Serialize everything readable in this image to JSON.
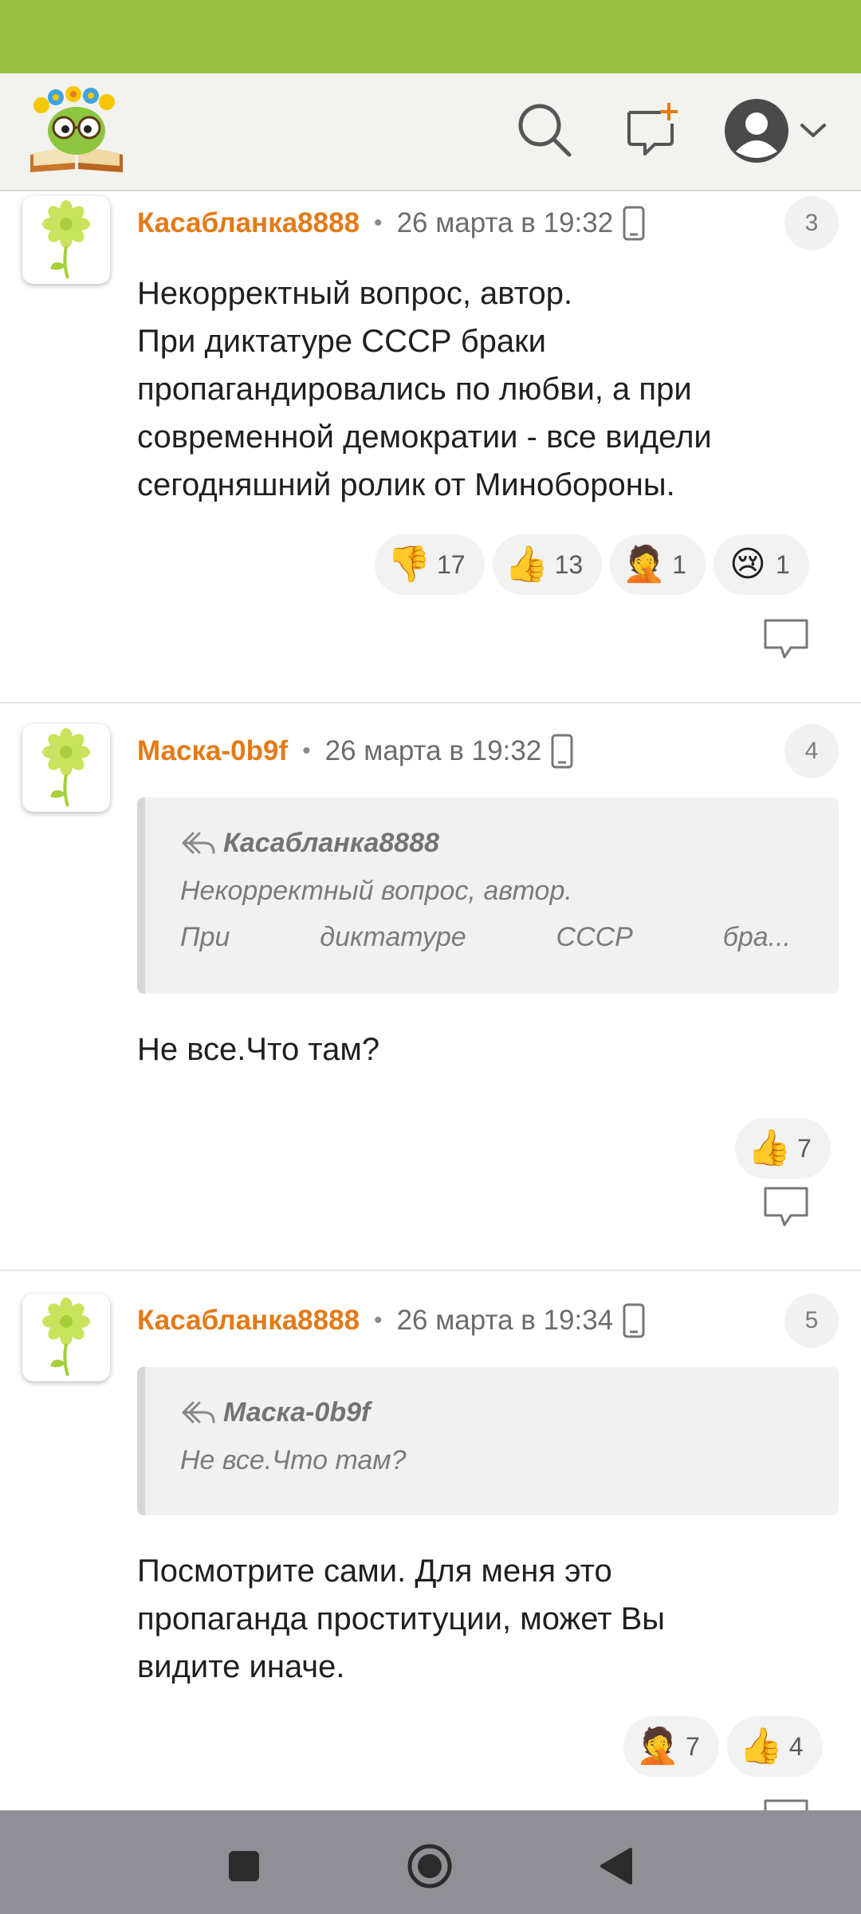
{
  "colors": {
    "status_bar": "#9cc245",
    "header_bg": "#f2f2ee",
    "author": "#e47a16",
    "quote_bg": "#f1f1f1",
    "nav_bar": "#8f8f95"
  },
  "header": {
    "icons": [
      "logo-icon",
      "search-icon",
      "new-post-icon",
      "user-avatar-icon",
      "chevron-down-icon"
    ]
  },
  "comments": [
    {
      "author": "Касабланка8888",
      "date": "26 марта в 19:32",
      "number": "3",
      "body": [
        "Некорректный вопрос, автор.",
        "При диктатуре СССР браки",
        "пропагандировались по любви, а при",
        "современной демократии - все видели",
        "сегодняшний ролик от Минобороны."
      ],
      "reactions": [
        {
          "emoji": "👎",
          "icon": "thumbs-down-icon",
          "count": "17"
        },
        {
          "emoji": "👍",
          "icon": "thumbs-up-icon",
          "count": "13"
        },
        {
          "emoji": "🤦",
          "icon": "facepalm-icon",
          "count": "1"
        },
        {
          "emoji": "😢",
          "icon": "crying-face-icon",
          "count": "1"
        }
      ]
    },
    {
      "author": "Маска-0b9f",
      "date": "26 марта в 19:32",
      "number": "4",
      "quote": {
        "author": "Касабланка8888",
        "line1": "Некорректный вопрос, автор.",
        "line2": [
          "При",
          "диктатуре",
          "СССР",
          "бра..."
        ]
      },
      "body": [
        "Не все.Что там?"
      ],
      "reactions": [
        {
          "emoji": "👍",
          "icon": "thumbs-up-icon",
          "count": "7"
        }
      ]
    },
    {
      "author": "Касабланка8888",
      "date": "26 марта в 19:34",
      "number": "5",
      "quote": {
        "author": "Маска-0b9f",
        "line1": "Не все.Что там?"
      },
      "body": [
        "Посмотрите сами. Для меня это",
        "пропаганда проституции, может Вы",
        "видите иначе."
      ],
      "reactions": [
        {
          "emoji": "🤦",
          "icon": "facepalm-icon",
          "count": "7"
        },
        {
          "emoji": "👍",
          "icon": "thumbs-up-icon",
          "count": "4"
        }
      ]
    }
  ],
  "nav": {
    "icons": [
      "recents-square-icon",
      "home-circle-icon",
      "back-triangle-icon"
    ]
  }
}
